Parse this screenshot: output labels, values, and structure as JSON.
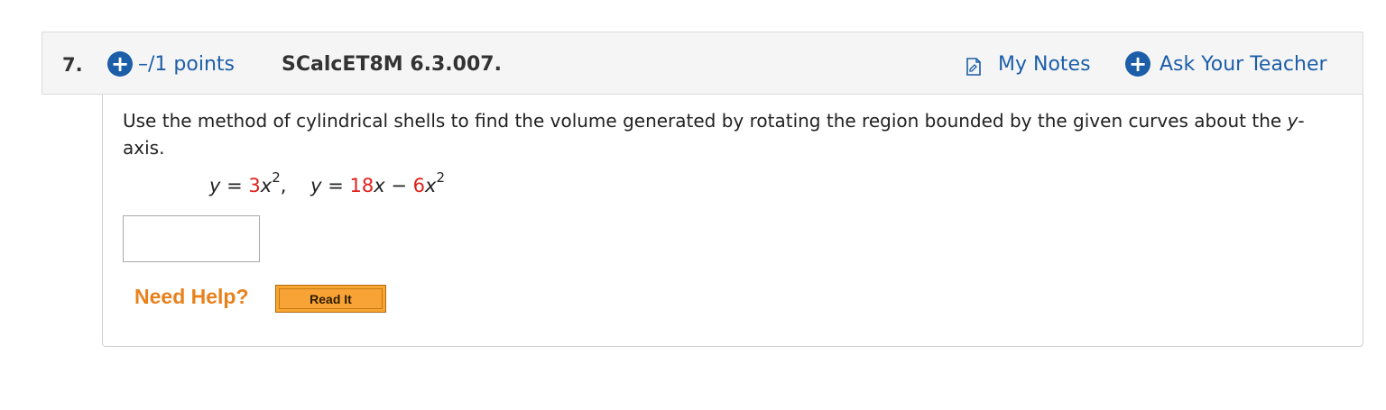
{
  "question": {
    "number": "7.",
    "points": "–/1 points",
    "code": "SCalcET8M 6.3.007.",
    "my_notes": "My Notes",
    "ask_teacher": "Ask Your Teacher"
  },
  "prompt": {
    "part1": "Use the method of cylindrical shells to find the volume generated by rotating the region bounded by the given curves about the ",
    "axis_var": "y",
    "part2": "-axis."
  },
  "equation": {
    "y1_coef": "3",
    "y1_exp": "2",
    "y2_coef1": "18",
    "y2_coef2": "6",
    "y2_exp": "2"
  },
  "answer": {
    "value": ""
  },
  "help": {
    "label": "Need Help?",
    "read_it": "Read It"
  },
  "colors": {
    "link_blue": "#1c5ea8",
    "coef_red": "#e0201a",
    "help_orange": "#e8811c",
    "button_orange": "#f9a630"
  },
  "icons": {
    "points": "plus-circle-icon",
    "notes": "note-icon",
    "ask": "plus-circle-icon"
  }
}
